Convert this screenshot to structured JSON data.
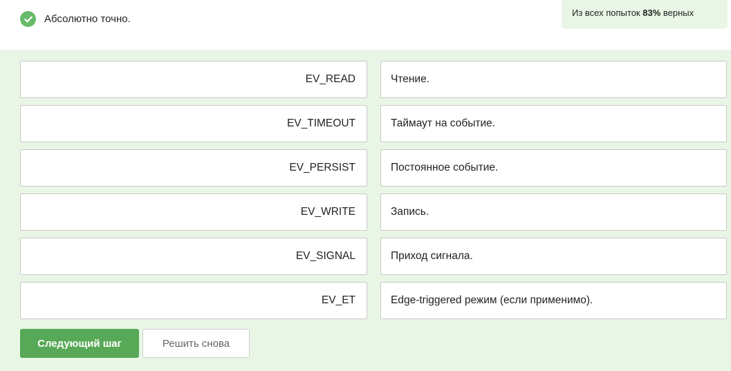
{
  "feedback": {
    "status_text": "Абсолютно точно.",
    "icon": "check-circle-icon",
    "color": "#66bb6a"
  },
  "stats": {
    "prefix": "Из всех попыток",
    "percent": "83%",
    "suffix": "верных"
  },
  "matches": [
    {
      "term": "EV_READ",
      "definition": "Чтение."
    },
    {
      "term": "EV_TIMEOUT",
      "definition": "Таймаут на событие."
    },
    {
      "term": "EV_PERSIST",
      "definition": "Постоянное событие."
    },
    {
      "term": "EV_WRITE",
      "definition": "Запись."
    },
    {
      "term": "EV_SIGNAL",
      "definition": "Приход сигнала."
    },
    {
      "term": "EV_ET",
      "definition": "Edge-triggered режим (если применимо)."
    }
  ],
  "buttons": {
    "next_label": "Следующий шаг",
    "retry_label": "Решить снова"
  },
  "colors": {
    "panel_bg": "#e9f6e5",
    "primary_button": "#57a957"
  }
}
